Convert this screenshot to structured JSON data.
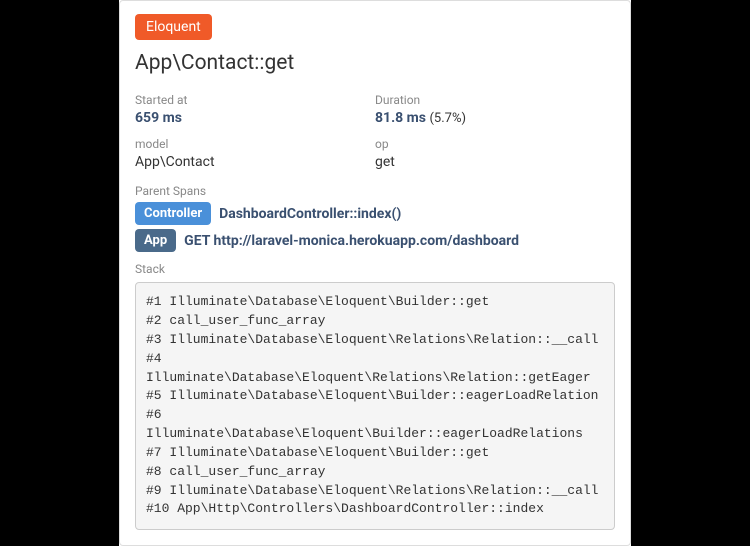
{
  "badge": "Eloquent",
  "title": "App\\Contact::get",
  "started_at": {
    "label": "Started at",
    "value": "659 ms"
  },
  "duration": {
    "label": "Duration",
    "value": "81.8 ms",
    "pct": "(5.7%)"
  },
  "model": {
    "label": "model",
    "value": "App\\Contact"
  },
  "op": {
    "label": "op",
    "value": "get"
  },
  "parent_spans": {
    "label": "Parent Spans",
    "items": [
      {
        "badge": "Controller",
        "text": "DashboardController::index()"
      },
      {
        "badge": "App",
        "text": "GET http://laravel-monica.herokuapp.com/dashboard"
      }
    ]
  },
  "stack": {
    "label": "Stack",
    "content": "#1 Illuminate\\Database\\Eloquent\\Builder::get\n#2 call_user_func_array\n#3 Illuminate\\Database\\Eloquent\\Relations\\Relation::__call\n#4 Illuminate\\Database\\Eloquent\\Relations\\Relation::getEager\n#5 Illuminate\\Database\\Eloquent\\Builder::eagerLoadRelation\n#6 Illuminate\\Database\\Eloquent\\Builder::eagerLoadRelations\n#7 Illuminate\\Database\\Eloquent\\Builder::get\n#8 call_user_func_array\n#9 Illuminate\\Database\\Eloquent\\Relations\\Relation::__call\n#10 App\\Http\\Controllers\\DashboardController::index"
  }
}
